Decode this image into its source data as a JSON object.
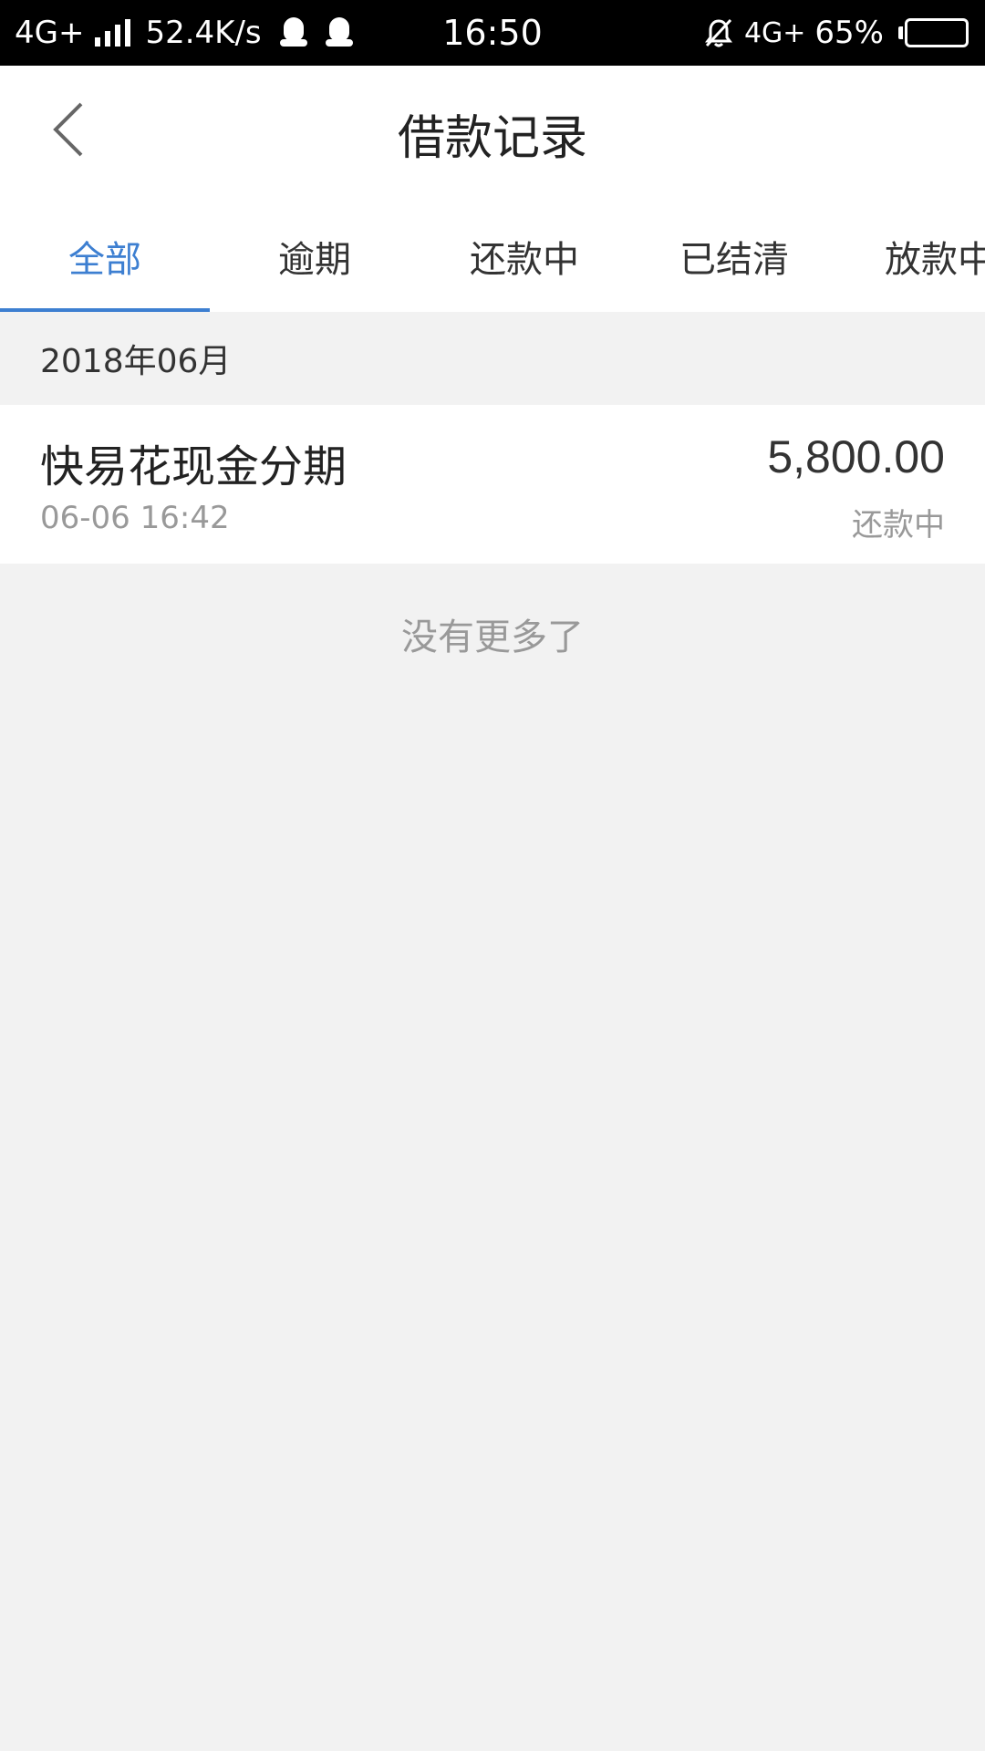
{
  "status_bar": {
    "network_left": "4G+",
    "speed": "52.4K/s",
    "time": "16:50",
    "network_right": "4G+",
    "battery_percent": "65%",
    "battery_level": 0.65
  },
  "header": {
    "title": "借款记录"
  },
  "tabs": [
    {
      "label": "全部",
      "active": true
    },
    {
      "label": "逾期",
      "active": false
    },
    {
      "label": "还款中",
      "active": false
    },
    {
      "label": "已结清",
      "active": false
    },
    {
      "label": "放款中",
      "active": false
    }
  ],
  "section": {
    "month": "2018年06月"
  },
  "loans": [
    {
      "name": "快易花现金分期",
      "time": "06-06 16:42",
      "amount": "5,800.00",
      "status": "还款中"
    }
  ],
  "footer": {
    "no_more": "没有更多了"
  },
  "colors": {
    "accent": "#3d7fd1",
    "background": "#f2f2f2"
  }
}
